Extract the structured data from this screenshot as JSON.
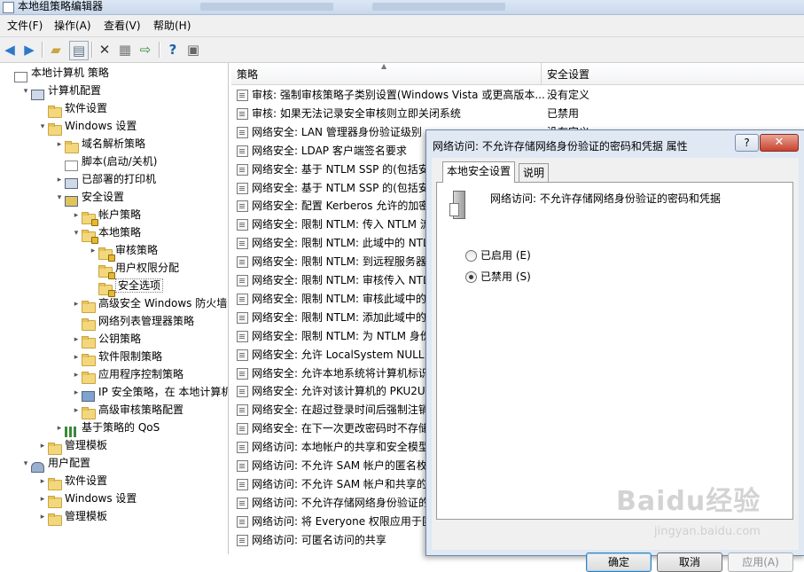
{
  "window": {
    "title": "本地组策略编辑器"
  },
  "menu": [
    "文件(F)",
    "操作(A)",
    "查看(V)",
    "帮助(H)"
  ],
  "toolbar": [
    "back-icon",
    "forward-icon",
    "up-folder-icon",
    "show-tree-icon",
    "delete-icon",
    "properties-icon",
    "export-icon",
    "help-icon",
    "console-icon"
  ],
  "tree": [
    {
      "label": "本地计算机 策略",
      "depth": 0,
      "icon": "policy",
      "arrow": ""
    },
    {
      "label": "计算机配置",
      "depth": 1,
      "icon": "pc",
      "arrow": "▾"
    },
    {
      "label": "软件设置",
      "depth": 2,
      "icon": "folder",
      "arrow": ""
    },
    {
      "label": "Windows 设置",
      "depth": 2,
      "icon": "folder",
      "arrow": "▾"
    },
    {
      "label": "域名解析策略",
      "depth": 3,
      "icon": "folder",
      "arrow": "▸"
    },
    {
      "label": "脚本(启动/关机)",
      "depth": 3,
      "icon": "doc",
      "arrow": ""
    },
    {
      "label": "已部署的打印机",
      "depth": 3,
      "icon": "printer",
      "arrow": "▸"
    },
    {
      "label": "安全设置",
      "depth": 3,
      "icon": "lock",
      "arrow": "▾"
    },
    {
      "label": "帐户策略",
      "depth": 4,
      "icon": "lockfolder",
      "arrow": "▸"
    },
    {
      "label": "本地策略",
      "depth": 4,
      "icon": "lockfolder",
      "arrow": "▾"
    },
    {
      "label": "审核策略",
      "depth": 5,
      "icon": "lockfolder",
      "arrow": "▸"
    },
    {
      "label": "用户权限分配",
      "depth": 5,
      "icon": "lockfolder",
      "arrow": ""
    },
    {
      "label": "安全选项",
      "depth": 5,
      "icon": "lockfolder",
      "arrow": "",
      "selected": true
    },
    {
      "label": "高级安全 Windows 防火墙",
      "depth": 4,
      "icon": "folder",
      "arrow": "▸"
    },
    {
      "label": "网络列表管理器策略",
      "depth": 4,
      "icon": "folder",
      "arrow": ""
    },
    {
      "label": "公钥策略",
      "depth": 4,
      "icon": "folder",
      "arrow": "▸"
    },
    {
      "label": "软件限制策略",
      "depth": 4,
      "icon": "folder",
      "arrow": "▸"
    },
    {
      "label": "应用程序控制策略",
      "depth": 4,
      "icon": "folder",
      "arrow": "▸"
    },
    {
      "label": "IP 安全策略，在 本地计算机",
      "depth": 4,
      "icon": "ipsec",
      "arrow": "▸"
    },
    {
      "label": "高级审核策略配置",
      "depth": 4,
      "icon": "folder",
      "arrow": "▸"
    },
    {
      "label": "基于策略的 QoS",
      "depth": 3,
      "icon": "qos",
      "arrow": "▸"
    },
    {
      "label": "管理模板",
      "depth": 2,
      "icon": "folder",
      "arrow": "▸"
    },
    {
      "label": "用户配置",
      "depth": 1,
      "icon": "user",
      "arrow": "▾"
    },
    {
      "label": "软件设置",
      "depth": 2,
      "icon": "folder",
      "arrow": "▸"
    },
    {
      "label": "Windows 设置",
      "depth": 2,
      "icon": "folder",
      "arrow": "▸"
    },
    {
      "label": "管理模板",
      "depth": 2,
      "icon": "folder",
      "arrow": "▸"
    }
  ],
  "list": {
    "columns": [
      "策略",
      "安全设置"
    ],
    "rows": [
      {
        "name": "审核: 强制审核策略子类别设置(Windows Vista 或更高版本...",
        "value": "没有定义"
      },
      {
        "name": "审核: 如果无法记录安全审核则立即关闭系统",
        "value": "已禁用"
      },
      {
        "name": "网络安全: LAN 管理器身份验证级别",
        "value": "没有定义"
      },
      {
        "name": "网络安全: LDAP 客户端签名要求",
        "value": ""
      },
      {
        "name": "网络安全: 基于 NTLM SSP 的(包括安",
        "value": ""
      },
      {
        "name": "网络安全: 基于 NTLM SSP 的(包括安",
        "value": ""
      },
      {
        "name": "网络安全: 配置 Kerberos 允许的加密",
        "value": ""
      },
      {
        "name": "网络安全: 限制 NTLM: 传入 NTLM 流",
        "value": ""
      },
      {
        "name": "网络安全: 限制 NTLM: 此域中的 NTL",
        "value": ""
      },
      {
        "name": "网络安全: 限制 NTLM: 到远程服务器",
        "value": ""
      },
      {
        "name": "网络安全: 限制 NTLM: 审核传入 NTL",
        "value": ""
      },
      {
        "name": "网络安全: 限制 NTLM: 审核此域中的",
        "value": ""
      },
      {
        "name": "网络安全: 限制 NTLM: 添加此域中的",
        "value": ""
      },
      {
        "name": "网络安全: 限制 NTLM: 为 NTLM 身份",
        "value": ""
      },
      {
        "name": "网络安全: 允许 LocalSystem NULL 会",
        "value": ""
      },
      {
        "name": "网络安全: 允许本地系统将计算机标识",
        "value": ""
      },
      {
        "name": "网络安全: 允许对该计算机的 PKU2U",
        "value": ""
      },
      {
        "name": "网络安全: 在超过登录时间后强制注销",
        "value": ""
      },
      {
        "name": "网络安全: 在下一次更改密码时不存储",
        "value": ""
      },
      {
        "name": "网络访问: 本地帐户的共享和安全模型",
        "value": ""
      },
      {
        "name": "网络访问: 不允许 SAM 帐户的匿名枚",
        "value": ""
      },
      {
        "name": "网络访问: 不允许 SAM 帐户和共享的",
        "value": ""
      },
      {
        "name": "网络访问: 不允许存储网络身份验证的",
        "value": ""
      },
      {
        "name": "网络访问: 将 Everyone 权限应用于匿",
        "value": ""
      },
      {
        "name": "网络访问: 可匿名访问的共享",
        "value": ""
      }
    ]
  },
  "dialog": {
    "title": "网络访问: 不允许存储网络身份验证的密码和凭据 属性",
    "help": "?",
    "close": "✕",
    "tabs": [
      "本地安全设置",
      "说明"
    ],
    "policy_name": "网络访问: 不允许存储网络身份验证的密码和凭据",
    "options": [
      {
        "label": "已启用 (E)",
        "checked": false
      },
      {
        "label": "已禁用 (S)",
        "checked": true
      }
    ],
    "buttons": {
      "ok": "确定",
      "cancel": "取消",
      "apply": "应用(A)"
    }
  },
  "watermark": {
    "logo": "Baidu经验",
    "url": "jingyan.baidu.com"
  }
}
